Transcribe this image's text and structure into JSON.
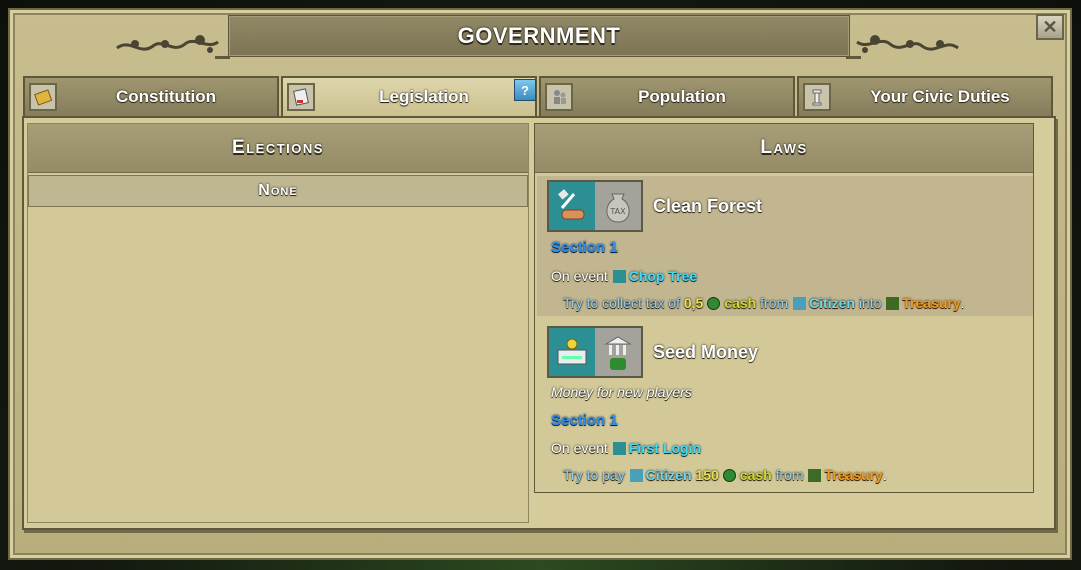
{
  "window": {
    "title": "GOVERNMENT",
    "close_glyph": "✕"
  },
  "tabs": [
    {
      "label": "Constitution",
      "icon": "scroll-icon",
      "active": false
    },
    {
      "label": "Legislation",
      "icon": "law-document-icon",
      "active": true
    },
    {
      "label": "Population",
      "icon": "people-icon",
      "active": false
    },
    {
      "label": "Your Civic Duties",
      "icon": "pillar-icon",
      "active": false
    }
  ],
  "help_badge": "?",
  "elections": {
    "title": "Elections",
    "empty_label": "None"
  },
  "laws": {
    "title": "Laws",
    "items": [
      {
        "name": "Clean Forest",
        "icons": [
          "axe-log-icon",
          "tax-bag-icon"
        ],
        "section": "Section 1",
        "event_prefix": "On event",
        "event": "Chop Tree",
        "action_prefix": "Try to collect tax of",
        "amount": "0,5",
        "currency": "cash",
        "from_word": "from",
        "source": "Citizen",
        "into_word": "into",
        "target": "Treasury",
        "end": "."
      },
      {
        "name": "Seed Money",
        "icons": [
          "bank-card-icon",
          "bank-money-icon"
        ],
        "description": "Money for new players",
        "section": "Section 1",
        "event_prefix": "On event",
        "event": "First Login",
        "action_prefix": "Try to pay",
        "target": "Citizen",
        "amount": "150",
        "currency": "cash",
        "from_word": "from",
        "source": "Treasury",
        "end": "."
      }
    ]
  },
  "colors": {
    "frame": "#c7bd8e",
    "title_bar": "#857d5b",
    "section_blue": "#2f8ee8",
    "event_cyan": "#48d8ef",
    "cash_yellow": "#d4d82c",
    "treasury_orange": "#f09a20"
  }
}
